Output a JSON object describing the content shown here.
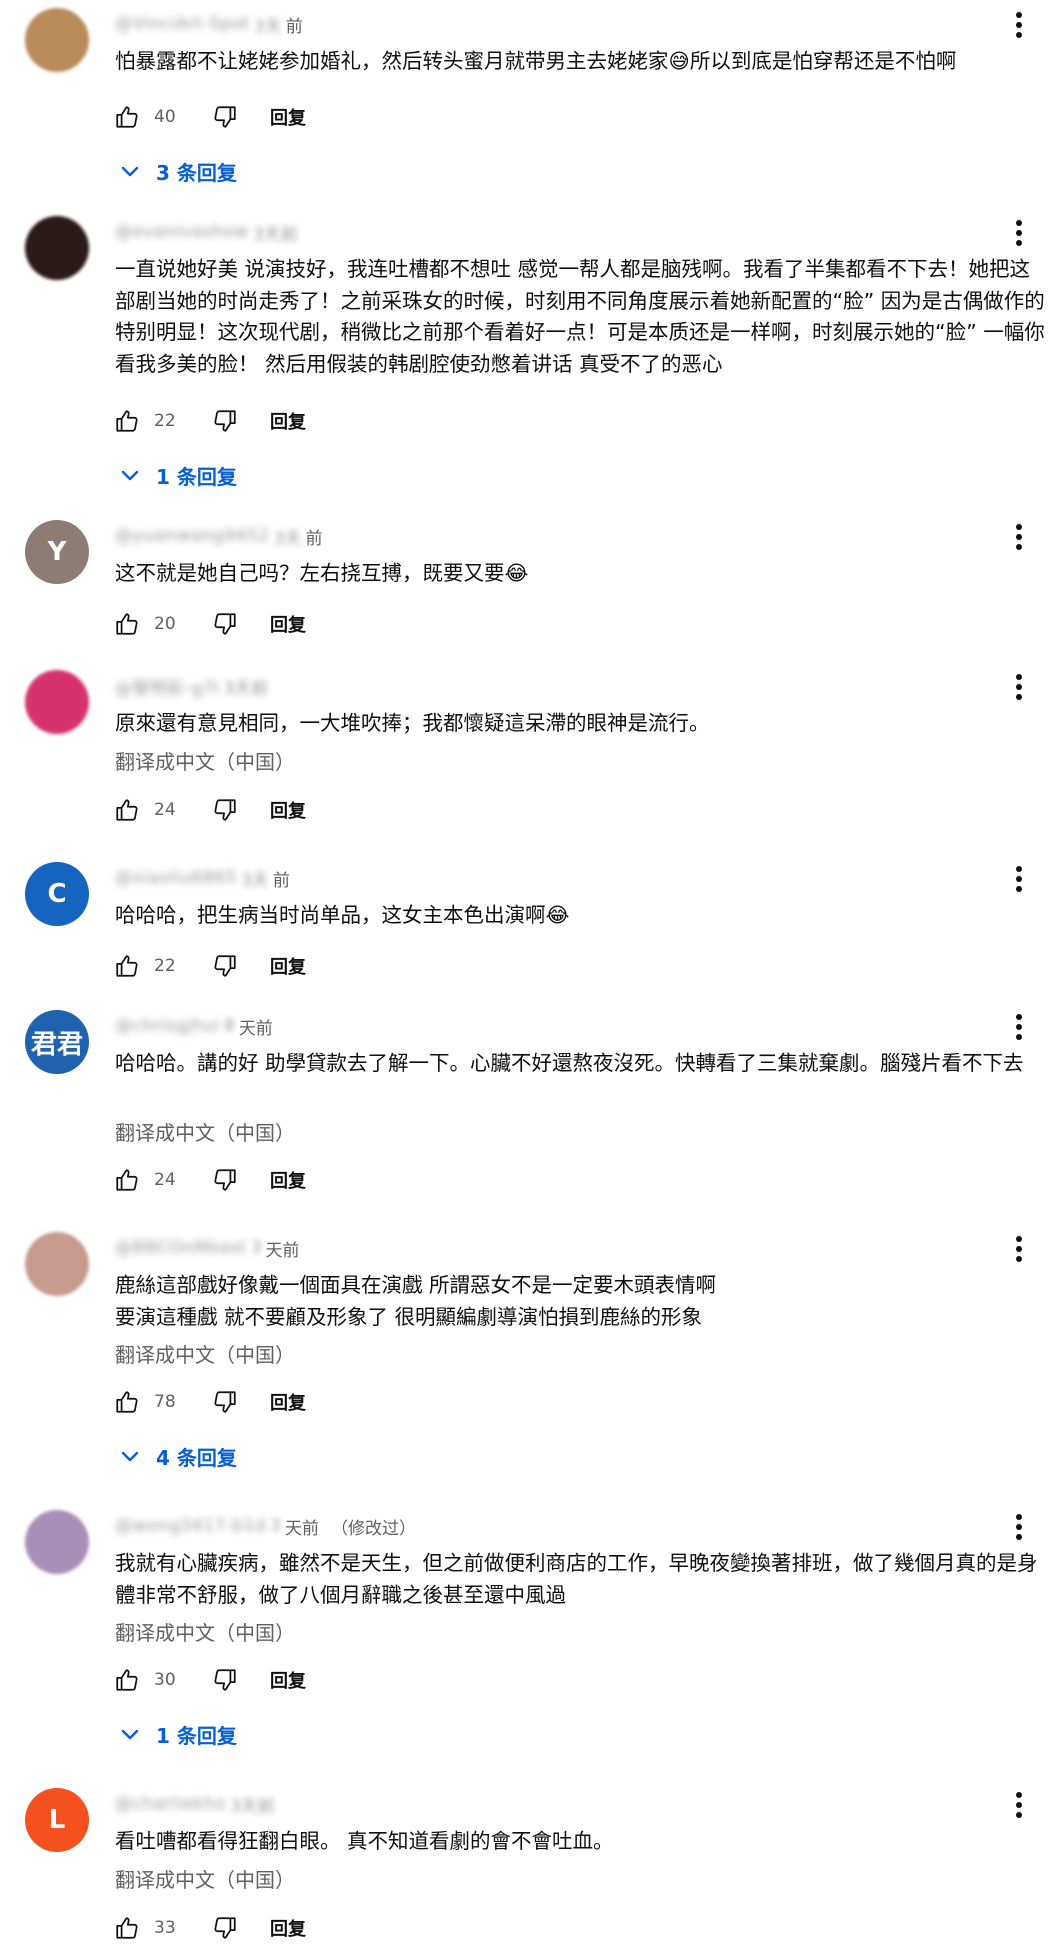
{
  "ui": {
    "reply_label": "回复",
    "translate_label": "翻译成中文（中国）"
  },
  "comments": [
    {
      "avatar_letter": "",
      "avatar_color": "#b98b5a",
      "handle": "@VinciArt-Spot",
      "time_blur": "3天",
      "time": "前",
      "edited": "",
      "text": "怕暴露都不让姥姥参加婚礼，然后转头蜜月就带男主去姥姥家😅所以到底是怕穿帮还是不怕啊",
      "translate": false,
      "likes": "40",
      "replies": "3 条回复"
    },
    {
      "avatar_letter": "",
      "avatar_color": "#2a1a1a",
      "handle": "@evanivashow",
      "time_blur": "3天前",
      "time": "",
      "edited": "",
      "text": "一直说她好美 说演技好，我连吐槽都不想吐 感觉一帮人都是脑残啊。我看了半集都看不下去！她把这部剧当她的时尚走秀了！之前采珠女的时候，时刻用不同角度展示着她新配置的“脸” 因为是古偶做作的特别明显！这次现代剧，稍微比之前那个看着好一点！可是本质还是一样啊，时刻展示她的“脸” 一幅你看我多美的脸！ 然后用假装的韩剧腔使劲憋着讲话 真受不了的恶心",
      "translate": false,
      "likes": "22",
      "replies": "1 条回复"
    },
    {
      "avatar_letter": "Y",
      "avatar_color": "#8d7b74",
      "handle": "@yuanwang9452",
      "time_blur": "3天",
      "time": "前",
      "edited": "",
      "text": "这不就是她自己吗？左右挠互搏，既要又要😂",
      "translate": false,
      "likes": "20",
      "replies": ""
    },
    {
      "avatar_letter": "",
      "avatar_color": "#d6336c",
      "handle": "@黎明彩-g7l",
      "time_blur": "3天前",
      "time": "",
      "edited": "",
      "text": "原來還有意見相同，一大堆吹捧；我都懷疑這呆滯的眼神是流行。",
      "translate": true,
      "likes": "24",
      "replies": ""
    },
    {
      "avatar_letter": "C",
      "avatar_color": "#1565c0",
      "handle": "@xiaoliu6865",
      "time_blur": "3天",
      "time": "前",
      "edited": "",
      "text": "哈哈哈，把生病当时尚单品，这女主本色出演啊😂",
      "translate": false,
      "likes": "22",
      "replies": ""
    },
    {
      "avatar_letter": "君君",
      "avatar_color": "#1e62b0",
      "handle": "@chrisgjhui",
      "time_blur": "8",
      "time": "天前",
      "edited": "",
      "text": "哈哈哈。講的好  助學貸款去了解一下。心臟不好還熬夜沒死。快轉看了三集就棄劇。腦殘片看不下去",
      "translate": true,
      "likes": "24",
      "replies": ""
    },
    {
      "avatar_letter": "",
      "avatar_color": "#c79a8e",
      "handle": "@BBCOnMkast",
      "time_blur": "3",
      "time": "天前",
      "edited": "",
      "text": "鹿絲這部戲好像戴一個面具在演戲 所謂惡女不是一定要木頭表情啊\n要演這種戲 就不要顧及形象了 很明顯編劇導演怕損到鹿絲的形象",
      "translate": true,
      "likes": "78",
      "replies": "4 条回复"
    },
    {
      "avatar_letter": "",
      "avatar_color": "#a88fb8",
      "handle": "@wong3417-b1d",
      "time_blur": "3",
      "time": "天前",
      "edited": "（修改过）",
      "text": "我就有心臟疾病，雖然不是天生，但之前做便利商店的工作，早晚夜變換著排班，做了幾個月真的是身體非常不舒服，做了八個月辭職之後甚至還中風過",
      "translate": true,
      "likes": "30",
      "replies": "1 条回复"
    },
    {
      "avatar_letter": "L",
      "avatar_color": "#f4511e",
      "handle": "@charliekho",
      "time_blur": "3天前",
      "time": "",
      "edited": "",
      "text": "看吐嘈都看得狂翻白眼。 真不知道看劇的會不會吐血。",
      "translate": true,
      "likes": "33",
      "replies": ""
    }
  ]
}
